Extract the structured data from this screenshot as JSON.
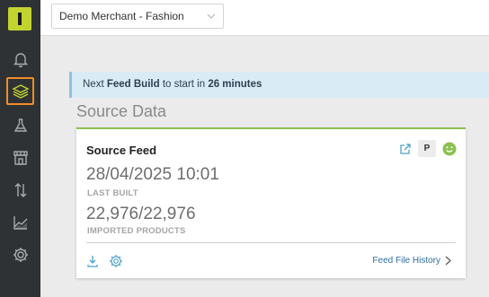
{
  "header": {
    "merchant_select": "Demo Merchant - Fashion"
  },
  "banner": {
    "prefix": "Next ",
    "feature": "Feed Build",
    "middle": " to start in ",
    "time": "26 minutes"
  },
  "section": {
    "title": "Source Data"
  },
  "card": {
    "title": "Source Feed",
    "badge": "P",
    "last_built_value": "28/04/2025 10:01",
    "last_built_label": "LAST BUILT",
    "imported_value": "22,976/22,976",
    "imported_label": "IMPORTED PRODUCTS",
    "history_link": "Feed File History"
  },
  "sidebar": {
    "items": [
      {
        "icon": "bell-icon"
      },
      {
        "icon": "layers-icon",
        "active": true
      },
      {
        "icon": "flask-icon"
      },
      {
        "icon": "store-icon"
      },
      {
        "icon": "arrows-updown-icon"
      },
      {
        "icon": "chart-icon"
      },
      {
        "icon": "gear-icon"
      }
    ]
  },
  "colors": {
    "sidebar_bg": "#2f3235",
    "logo": "#c2d330",
    "active_outline": "#f28c28",
    "card_accent": "#8cc152",
    "banner_bg": "#d9ecf5",
    "link": "#2d6ea3"
  }
}
